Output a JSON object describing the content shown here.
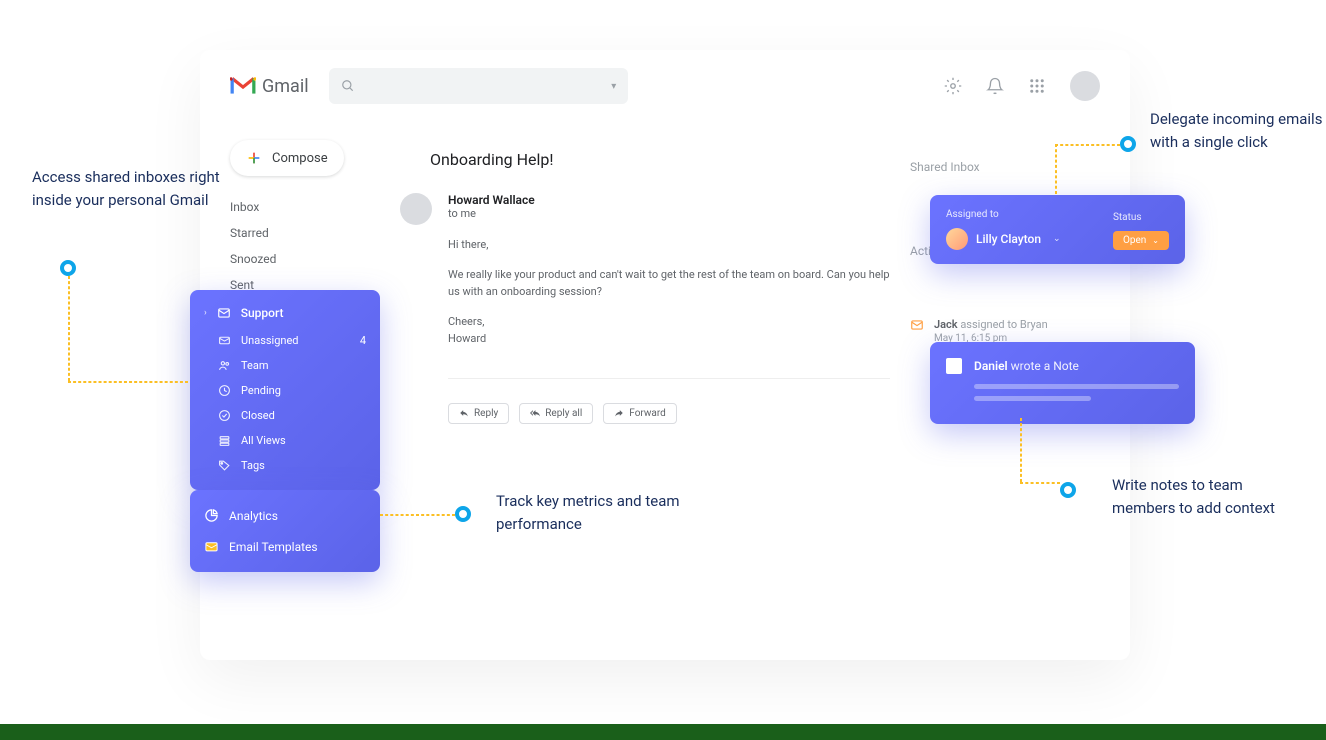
{
  "header": {
    "brand": "Gmail",
    "search_placeholder": ""
  },
  "compose_label": "Compose",
  "sidebar": {
    "items": [
      "Inbox",
      "Starred",
      "Snoozed",
      "Sent"
    ]
  },
  "support": {
    "title": "Support",
    "items": [
      {
        "label": "Unassigned",
        "count": "4"
      },
      {
        "label": "Team"
      },
      {
        "label": "Pending"
      },
      {
        "label": "Closed"
      },
      {
        "label": "All Views"
      },
      {
        "label": "Tags"
      }
    ]
  },
  "tools": {
    "analytics": "Analytics",
    "templates": "Email Templates"
  },
  "email": {
    "subject": "Onboarding Help!",
    "sender": "Howard Wallace",
    "to": "to me",
    "greeting": "Hi there,",
    "body1": "We really like your product and can't wait to get the rest of the team on board. Can you help us with an onboarding session?",
    "body2": "Cheers,",
    "body3": "Howard",
    "reply": "Reply",
    "reply_all": "Reply all",
    "forward": "Forward"
  },
  "right": {
    "shared_inbox": "Shared Inbox",
    "activity": "Activity",
    "assigned_to_label": "Assigned to",
    "assignee": "Lilly Clayton",
    "status_label": "Status",
    "status_value": "Open",
    "note_author": "Daniel",
    "note_action": "wrote a Note",
    "log_name": "Jack",
    "log_text": "assigned to Bryan",
    "log_date": "May 11, 6:15 pm"
  },
  "annotations": {
    "a1": "Access shared inboxes right inside your personal Gmail",
    "a2": "Track key metrics and team performance",
    "a3": "Delegate incoming emails with a single click",
    "a4": "Write notes to team members to add context"
  }
}
